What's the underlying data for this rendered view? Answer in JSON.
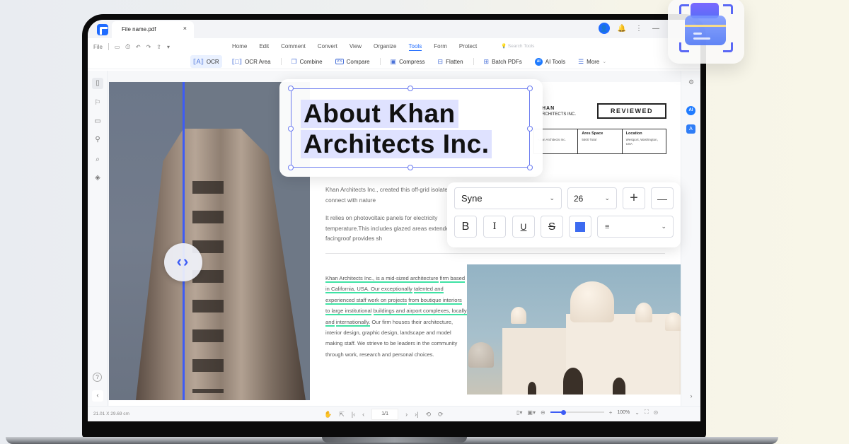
{
  "window": {
    "file_tab": "File name.pdf",
    "close_glyph": "×",
    "avatar_glyph": "●",
    "bell_glyph": "🔔",
    "more_glyph": "⋮",
    "minimize_glyph": "—"
  },
  "menu": {
    "file_label": "File",
    "quick_icons": [
      "save-icon",
      "print-icon",
      "undo-icon",
      "redo-icon",
      "share-icon",
      "dropdown-icon"
    ],
    "tabs": [
      "Home",
      "Edit",
      "Comment",
      "Convert",
      "View",
      "Organize",
      "Tools",
      "Form",
      "Protect"
    ],
    "active_tab": "Tools",
    "search_placeholder": "Search Tools"
  },
  "toolbar": {
    "tools": [
      {
        "label": "OCR",
        "icon": "⟦A⟧",
        "active": true
      },
      {
        "label": "OCR Area",
        "icon": "⟦□⟧"
      },
      {
        "label": "Combine",
        "icon": "❐"
      },
      {
        "label": "Compare",
        "icon": "VS"
      },
      {
        "label": "Compress",
        "icon": "▣"
      },
      {
        "label": "Flatten",
        "icon": "⊟"
      },
      {
        "label": "Batch PDFs",
        "icon": "⊞"
      },
      {
        "label": "AI Tools",
        "icon": "AI"
      },
      {
        "label": "More",
        "icon": "☰"
      }
    ]
  },
  "left_sidebar": {
    "items": [
      "page-thumbnail",
      "bookmark",
      "comment",
      "attachment",
      "search",
      "layers"
    ],
    "help_glyph": "?",
    "collapse_glyph": "‹"
  },
  "right_sidebar": {
    "settings_glyph": "⚙",
    "ai_label": "AI",
    "translate_label": "A"
  },
  "document": {
    "heading_line1": "About Khan",
    "heading_line2": "Architects Inc.",
    "company_name": "HAN",
    "company_sub": "RCHITECTS INC.",
    "reviewed_stamp": "REVIEWED",
    "table": {
      "col1_value": "Khan Architects Inc.",
      "col2_header": "Ares Space",
      "col2_value": "5500 Total",
      "col3_header": "Location",
      "col3_value": "Westport, Washington, USA"
    },
    "para1": "Khan Architects Inc., created this off-grid isolated place to connect with nature",
    "para2": "It relies on photovoltaic panels for electricity temperature.This includes glazed areas extended west-facingroof provides sh",
    "para3_highlighted": [
      "Khan Architects Inc., is a mid-sized architecture",
      "firm based in California, USA. Our exceptionally",
      "talented and experienced staff work on projects",
      "from boutique interiors to large institutional",
      "buildings and airport complexes, locally and",
      "internationally."
    ],
    "para3_rest": " Our firm houses their architecture, interior design, graphic design, landscape and model making staff. We strieve to be leaders in the community through work, research and personal choices.",
    "compare_handle_glyph": "‹›"
  },
  "format_toolbar": {
    "font_family": "Syne",
    "font_size": "26",
    "increase_glyph": "+",
    "decrease_glyph": "—",
    "bold": "B",
    "italic": "I",
    "underline": "U",
    "strike": "S",
    "color": "#3d6bf0",
    "align_glyph": "≡",
    "chevron": "⌄"
  },
  "statusbar": {
    "dimensions": "21.01 X 29.69 cm",
    "page": "1/1",
    "zoom_level": "100%",
    "zoom_slider_fraction": 0.25,
    "nav_glyphs": [
      "✋",
      "⇱",
      "|‹",
      "‹",
      "›",
      "›|",
      "⟲",
      "⟳"
    ]
  },
  "colors": {
    "accent": "#1f6bff",
    "selection": "#6b7bf0",
    "highlight_underline": "#3ee2a4",
    "compare_line": "#3d5cf5"
  }
}
